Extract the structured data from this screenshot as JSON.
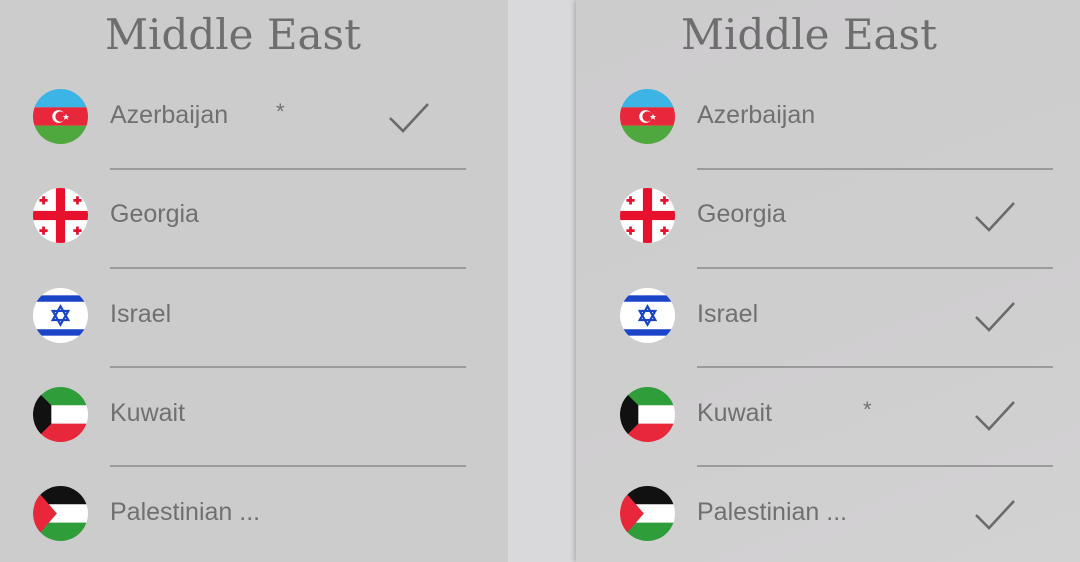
{
  "left_panel": {
    "title": "Middle East",
    "items": [
      {
        "name": "Azerbaijan",
        "flag": "azerbaijan-flag-icon",
        "starred": true,
        "checked": true
      },
      {
        "name": "Georgia",
        "flag": "georgia-flag-icon",
        "starred": false,
        "checked": false
      },
      {
        "name": "Israel",
        "flag": "israel-flag-icon",
        "starred": false,
        "checked": false
      },
      {
        "name": "Kuwait",
        "flag": "kuwait-flag-icon",
        "starred": false,
        "checked": false
      },
      {
        "name": "Palestinian ...",
        "flag": "palestine-flag-icon",
        "starred": false,
        "checked": false
      }
    ]
  },
  "right_panel": {
    "title": "Middle East",
    "items": [
      {
        "name": "Azerbaijan",
        "flag": "azerbaijan-flag-icon",
        "starred": false,
        "checked": false
      },
      {
        "name": "Georgia",
        "flag": "georgia-flag-icon",
        "starred": false,
        "checked": true
      },
      {
        "name": "Israel",
        "flag": "israel-flag-icon",
        "starred": false,
        "checked": true
      },
      {
        "name": "Kuwait",
        "flag": "kuwait-flag-icon",
        "starred": true,
        "checked": true
      },
      {
        "name": "Palestinian ...",
        "flag": "palestine-flag-icon",
        "starred": false,
        "checked": true
      }
    ]
  },
  "star_glyph": "*",
  "colors": {
    "panel_bg": "#cdcccd",
    "text": "#707070",
    "divider": "#9c9b9c"
  }
}
